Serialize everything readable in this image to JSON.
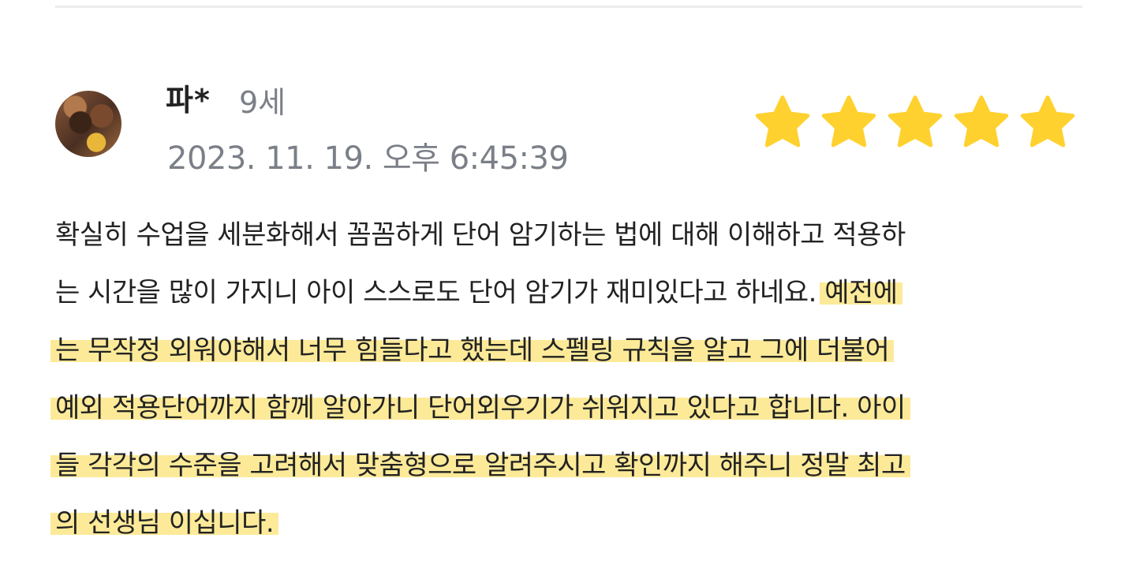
{
  "review": {
    "author_name": "파*",
    "author_age": "9세",
    "date": "2023. 11. 19. 오후 6:45:39",
    "rating": 5,
    "rating_max": 5,
    "star_color": "#FFD12F",
    "highlight_color": "#FADD5A",
    "lines": [
      {
        "plain": "확실히 수업을 세분화해서 꼼꼼하게 단어 암기하는 법에 대해 이해하고 적용하",
        "highlight": ""
      },
      {
        "plain": "는 시간을 많이 가지니 아이 스스로도 단어 암기가 재미있다고 하네요. ",
        "highlight": "예전에"
      },
      {
        "plain": "",
        "highlight": "는 무작정 외워야해서 너무 힘들다고 했는데 스펠링 규칙을 알고 그에 더불어"
      },
      {
        "plain": "",
        "highlight": "예외 적용단어까지 함께 알아가니 단어외우기가 쉬워지고 있다고 합니다. 아이"
      },
      {
        "plain": "",
        "highlight": "들 각각의 수준을 고려해서 맞춤형으로 알려주시고 확인까지 해주니 정말 최고"
      },
      {
        "plain": "",
        "highlight": "의 선생님 이십니다."
      }
    ]
  }
}
